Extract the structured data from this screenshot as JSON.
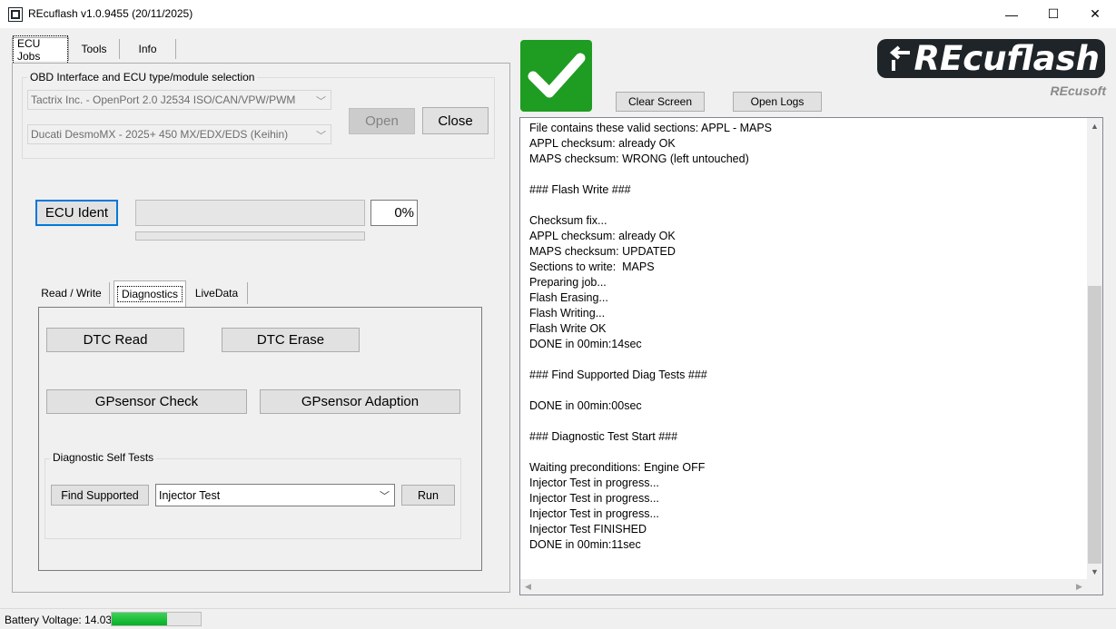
{
  "window": {
    "title": "REcuflash  v1.0.9455 (20/11/2025)",
    "minimize": "—",
    "maximize": "☐",
    "close": "✕"
  },
  "main_tabs": [
    {
      "label": "ECU Jobs"
    },
    {
      "label": "Tools"
    },
    {
      "label": "Info"
    }
  ],
  "obd_group": {
    "title": "OBD Interface and ECU type/module selection",
    "interface_value": "Tactrix Inc. - OpenPort 2.0 J2534 ISO/CAN/VPW/PWM",
    "ecu_value": "Ducati DesmoMX - 2025+ 450 MX/EDX/EDS (Keihin)",
    "open_label": "Open",
    "close_label": "Close"
  },
  "ident": {
    "button_label": "ECU Ident",
    "percent": "0%"
  },
  "sub_tabs": [
    {
      "label": "Read / Write"
    },
    {
      "label": "Diagnostics"
    },
    {
      "label": "LiveData"
    }
  ],
  "diagnostics": {
    "dtc_read": "DTC Read",
    "dtc_erase": "DTC Erase",
    "gpsensor_check": "GPsensor Check",
    "gpsensor_adaption": "GPsensor Adaption",
    "self_tests_title": "Diagnostic Self Tests",
    "find_supported": "Find Supported",
    "test_selected": "Injector Test",
    "run": "Run"
  },
  "toolbar": {
    "clear_screen": "Clear Screen",
    "open_logs": "Open Logs"
  },
  "logo": {
    "name": "REcuflash",
    "sub": "REcusoft"
  },
  "log_lines": [
    "File contains these valid sections: APPL - MAPS",
    "APPL checksum: already OK",
    "MAPS checksum: WRONG (left untouched)",
    "",
    "### Flash Write ###",
    "",
    "Checksum fix...",
    "APPL checksum: already OK",
    "MAPS checksum: UPDATED",
    "Sections to write:  MAPS",
    "Preparing job...",
    "Flash Erasing...",
    "Flash Writing...",
    "Flash Write OK",
    "DONE in 00min:14sec",
    "",
    "### Find Supported Diag Tests ###",
    "",
    "DONE in 00min:00sec",
    "",
    "### Diagnostic Test Start ###",
    "",
    "Waiting preconditions: Engine OFF",
    "Injector Test in progress...",
    "Injector Test in progress...",
    "Injector Test in progress...",
    "Injector Test FINISHED",
    "DONE in 00min:11sec"
  ],
  "status": {
    "battery_label": "Battery Voltage: 14.03",
    "battery_level": 0.62
  },
  "colors": {
    "success_green": "#1f9c22",
    "accent_blue": "#0078d7",
    "battery_green": "#22b13c",
    "logo_dark": "#1e2428"
  }
}
